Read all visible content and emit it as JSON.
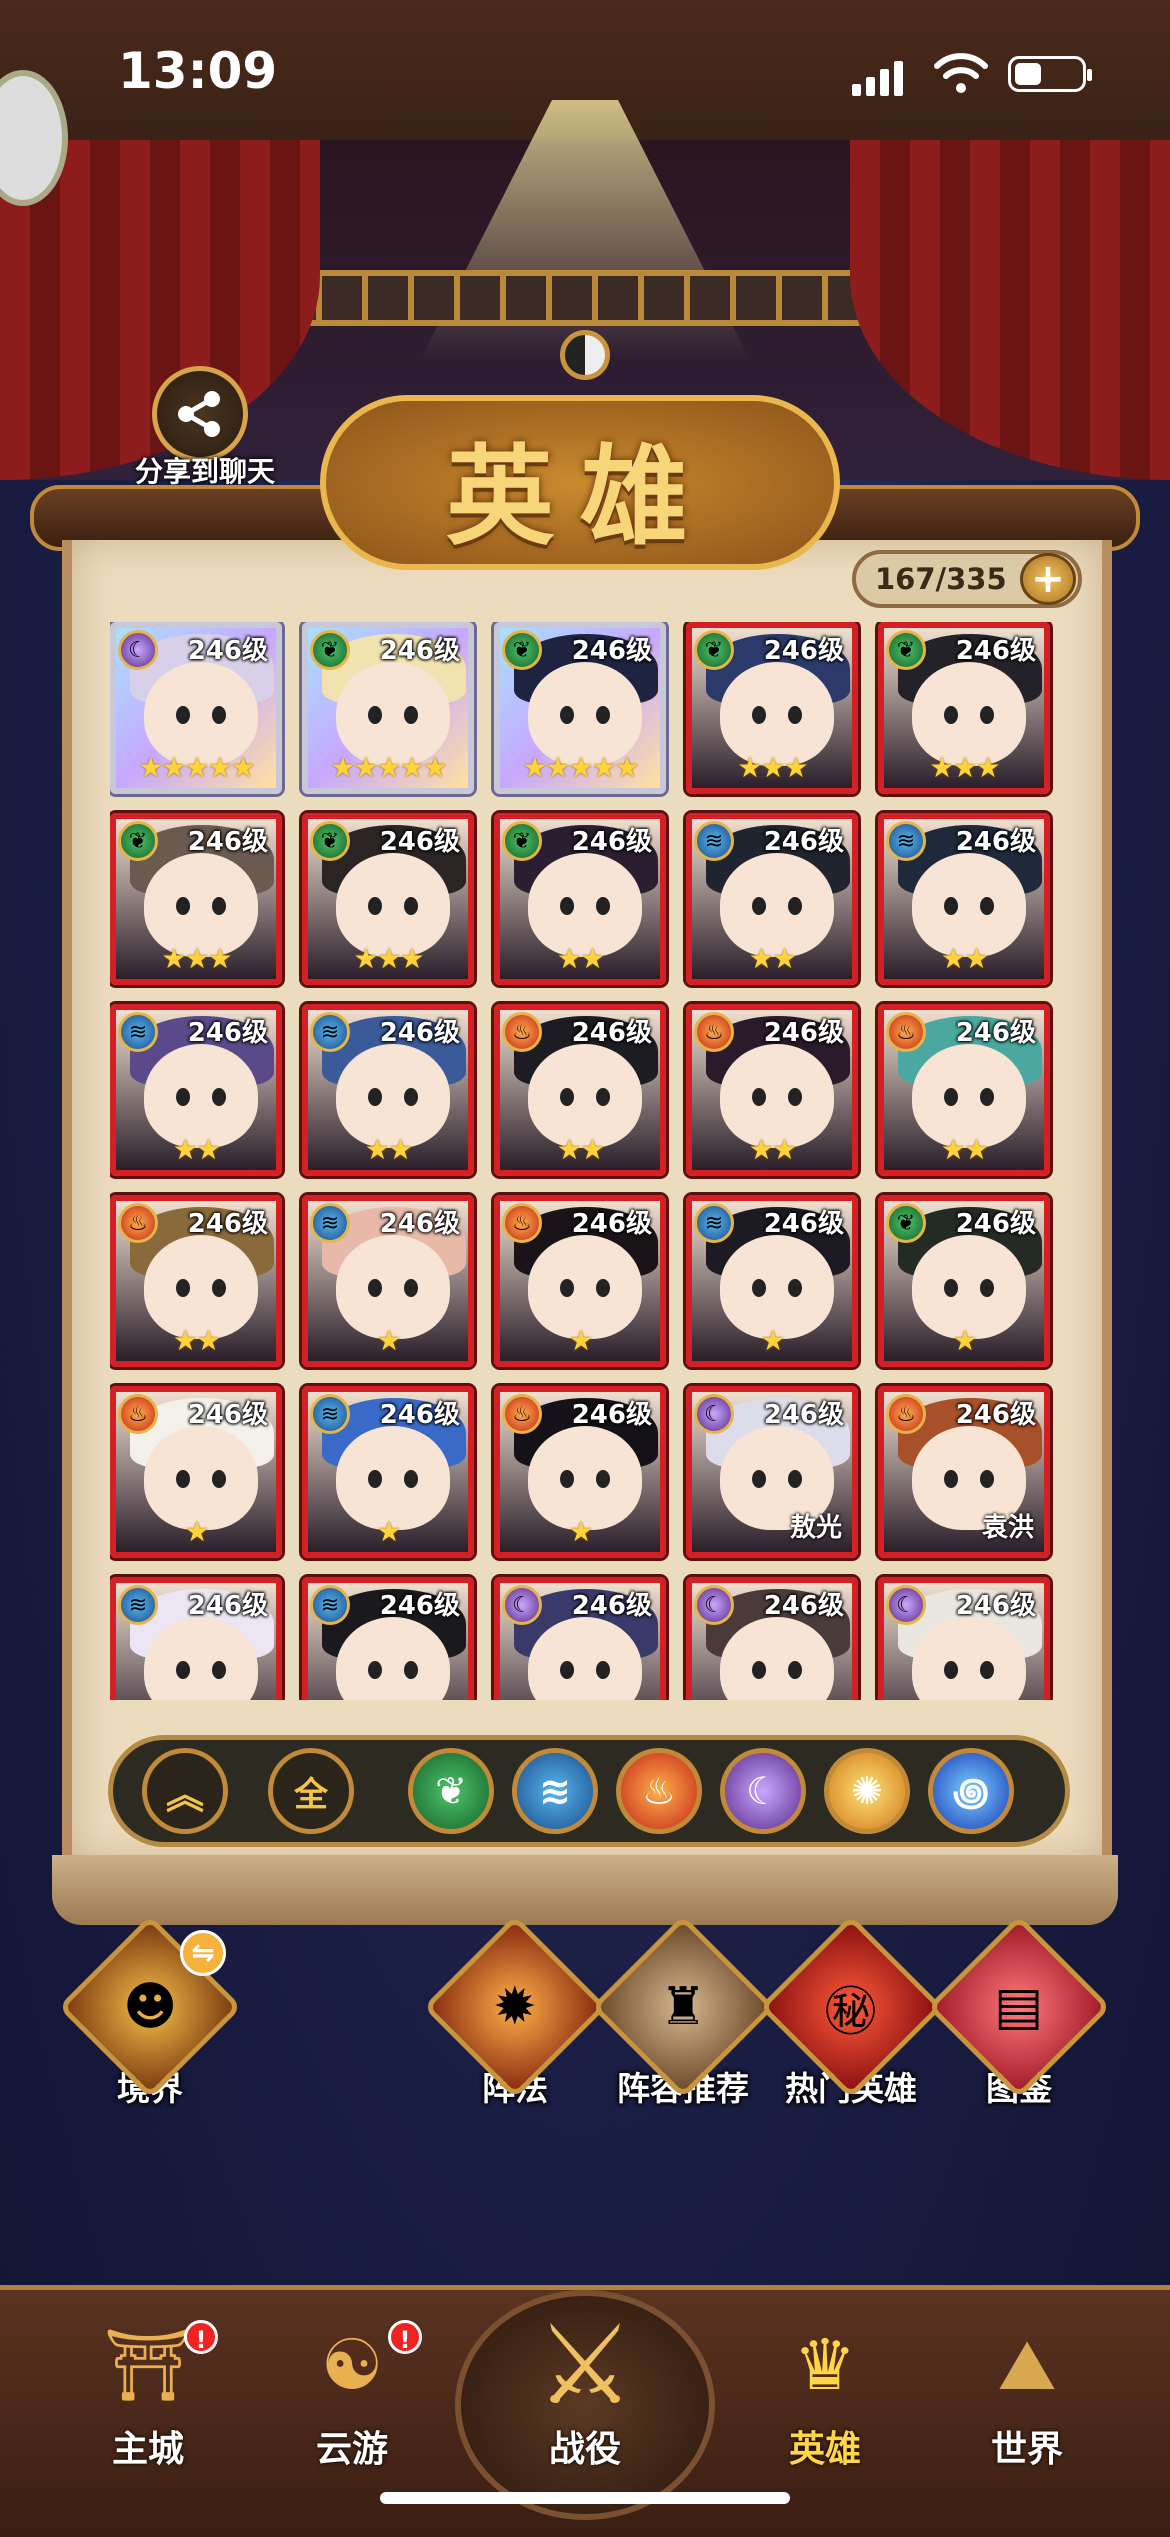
{
  "status_bar": {
    "time": "13:09"
  },
  "share": {
    "label": "分享到聊天"
  },
  "page": {
    "title": "英雄"
  },
  "collection": {
    "count": "167/335",
    "add": "+"
  },
  "heroes": [
    {
      "level": "246级",
      "element": "moon",
      "stars": "★★★★★",
      "name": "",
      "color": "#d8d0e8"
    },
    {
      "level": "246级",
      "element": "wood",
      "stars": "★★★★★",
      "name": "",
      "color": "#f2e2b0"
    },
    {
      "level": "246级",
      "element": "wood",
      "stars": "★★★★★",
      "name": "",
      "color": "#1e2440"
    },
    {
      "level": "246级",
      "element": "wood",
      "stars": "★★★",
      "name": "",
      "color": "#2b3a6a"
    },
    {
      "level": "246级",
      "element": "wood",
      "stars": "★★★",
      "name": "",
      "color": "#222228"
    },
    {
      "level": "246级",
      "element": "wood",
      "stars": "★★★",
      "name": "",
      "color": "#6a5a50"
    },
    {
      "level": "246级",
      "element": "wood",
      "stars": "★★★",
      "name": "",
      "color": "#2a2424"
    },
    {
      "level": "246级",
      "element": "wood",
      "stars": "★★",
      "name": "",
      "color": "#2a1e30"
    },
    {
      "level": "246级",
      "element": "water",
      "stars": "★★",
      "name": "",
      "color": "#20242e"
    },
    {
      "level": "246级",
      "element": "water",
      "stars": "★★",
      "name": "",
      "color": "#1e2a3c"
    },
    {
      "level": "246级",
      "element": "water",
      "stars": "★★",
      "name": "",
      "color": "#5a4a8a"
    },
    {
      "level": "246级",
      "element": "water",
      "stars": "★★",
      "name": "",
      "color": "#3a5a9a"
    },
    {
      "level": "246级",
      "element": "fire",
      "stars": "★★",
      "name": "",
      "color": "#1c1c22"
    },
    {
      "level": "246级",
      "element": "fire",
      "stars": "★★",
      "name": "",
      "color": "#2a1a2a"
    },
    {
      "level": "246级",
      "element": "fire",
      "stars": "★★",
      "name": "",
      "color": "#4aa8a0"
    },
    {
      "level": "246级",
      "element": "fire",
      "stars": "★★",
      "name": "",
      "color": "#8a6a3a"
    },
    {
      "level": "246级",
      "element": "water",
      "stars": "★",
      "name": "",
      "color": "#e8b8a8"
    },
    {
      "level": "246级",
      "element": "fire",
      "stars": "★",
      "name": "",
      "color": "#1a1418"
    },
    {
      "level": "246级",
      "element": "water",
      "stars": "★",
      "name": "",
      "color": "#1c1a22"
    },
    {
      "level": "246级",
      "element": "wood",
      "stars": "★",
      "name": "",
      "color": "#242a24"
    },
    {
      "level": "246级",
      "element": "fire",
      "stars": "★",
      "name": "",
      "color": "#f4f0ea"
    },
    {
      "level": "246级",
      "element": "water",
      "stars": "★",
      "name": "",
      "color": "#3a6ac8"
    },
    {
      "level": "246级",
      "element": "fire",
      "stars": "★",
      "name": "",
      "color": "#141218"
    },
    {
      "level": "246级",
      "element": "moon",
      "stars": "",
      "name": "敖光",
      "color": "#dcdcea"
    },
    {
      "level": "246级",
      "element": "fire",
      "stars": "",
      "name": "袁洪",
      "color": "#a8502a"
    },
    {
      "level": "246级",
      "element": "water",
      "stars": "",
      "name": "",
      "color": "#ece6f4"
    },
    {
      "level": "246级",
      "element": "water",
      "stars": "",
      "name": "",
      "color": "#1a1a1e"
    },
    {
      "level": "246级",
      "element": "moon",
      "stars": "",
      "name": "",
      "color": "#3a3a6a"
    },
    {
      "level": "246级",
      "element": "moon",
      "stars": "",
      "name": "",
      "color": "#4a3a3a"
    },
    {
      "level": "246级",
      "element": "moon",
      "stars": "",
      "name": "",
      "color": "#eae6e0"
    }
  ],
  "filters": {
    "all_label": "全"
  },
  "actions": [
    {
      "label": "境界",
      "icon": "realm-icon"
    },
    {
      "label": "阵法",
      "icon": "formation-icon"
    },
    {
      "label": "阵容推荐",
      "icon": "lineup-icon"
    },
    {
      "label": "热门英雄",
      "icon": "hot-heroes-icon"
    },
    {
      "label": "图鉴",
      "icon": "codex-icon"
    }
  ],
  "nav": [
    {
      "label": "主城",
      "badge": "!"
    },
    {
      "label": "云游",
      "badge": "!"
    },
    {
      "label": "战役",
      "badge": ""
    },
    {
      "label": "英雄",
      "badge": ""
    },
    {
      "label": "世界",
      "badge": ""
    }
  ],
  "colors": {
    "card_border": "#d41f25",
    "accent_gold": "#c9953c",
    "active_nav": "#ffd54a"
  }
}
